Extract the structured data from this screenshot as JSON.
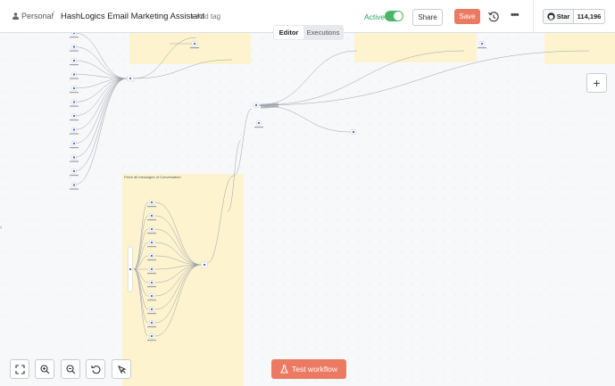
{
  "breadcrumb": {
    "owner": "Personal",
    "workflow_name": "HashLogics Email Marketing Assistant",
    "add_tag": "+ Add tag"
  },
  "status": {
    "active_label": "Active",
    "active": true
  },
  "actions": {
    "share": "Share",
    "save": "Save"
  },
  "github": {
    "star_label": "Star",
    "star_count": "114,196"
  },
  "tabs": [
    {
      "label": "Editor",
      "active": true
    },
    {
      "label": "Executions",
      "active": false
    }
  ],
  "canvas": {
    "sticky_note_label": "Fetch all messages of Conversation",
    "add_node_symbol": "+"
  },
  "controls": {
    "test_workflow": "Test workflow",
    "icons": [
      "fit-view-icon",
      "zoom-in-icon",
      "zoom-out-icon",
      "reset-zoom-icon",
      "tidy-up-icon"
    ]
  },
  "colors": {
    "accent": "#ec7a63",
    "active_green": "#4cb56a",
    "sticky": "#fdf3cf"
  }
}
